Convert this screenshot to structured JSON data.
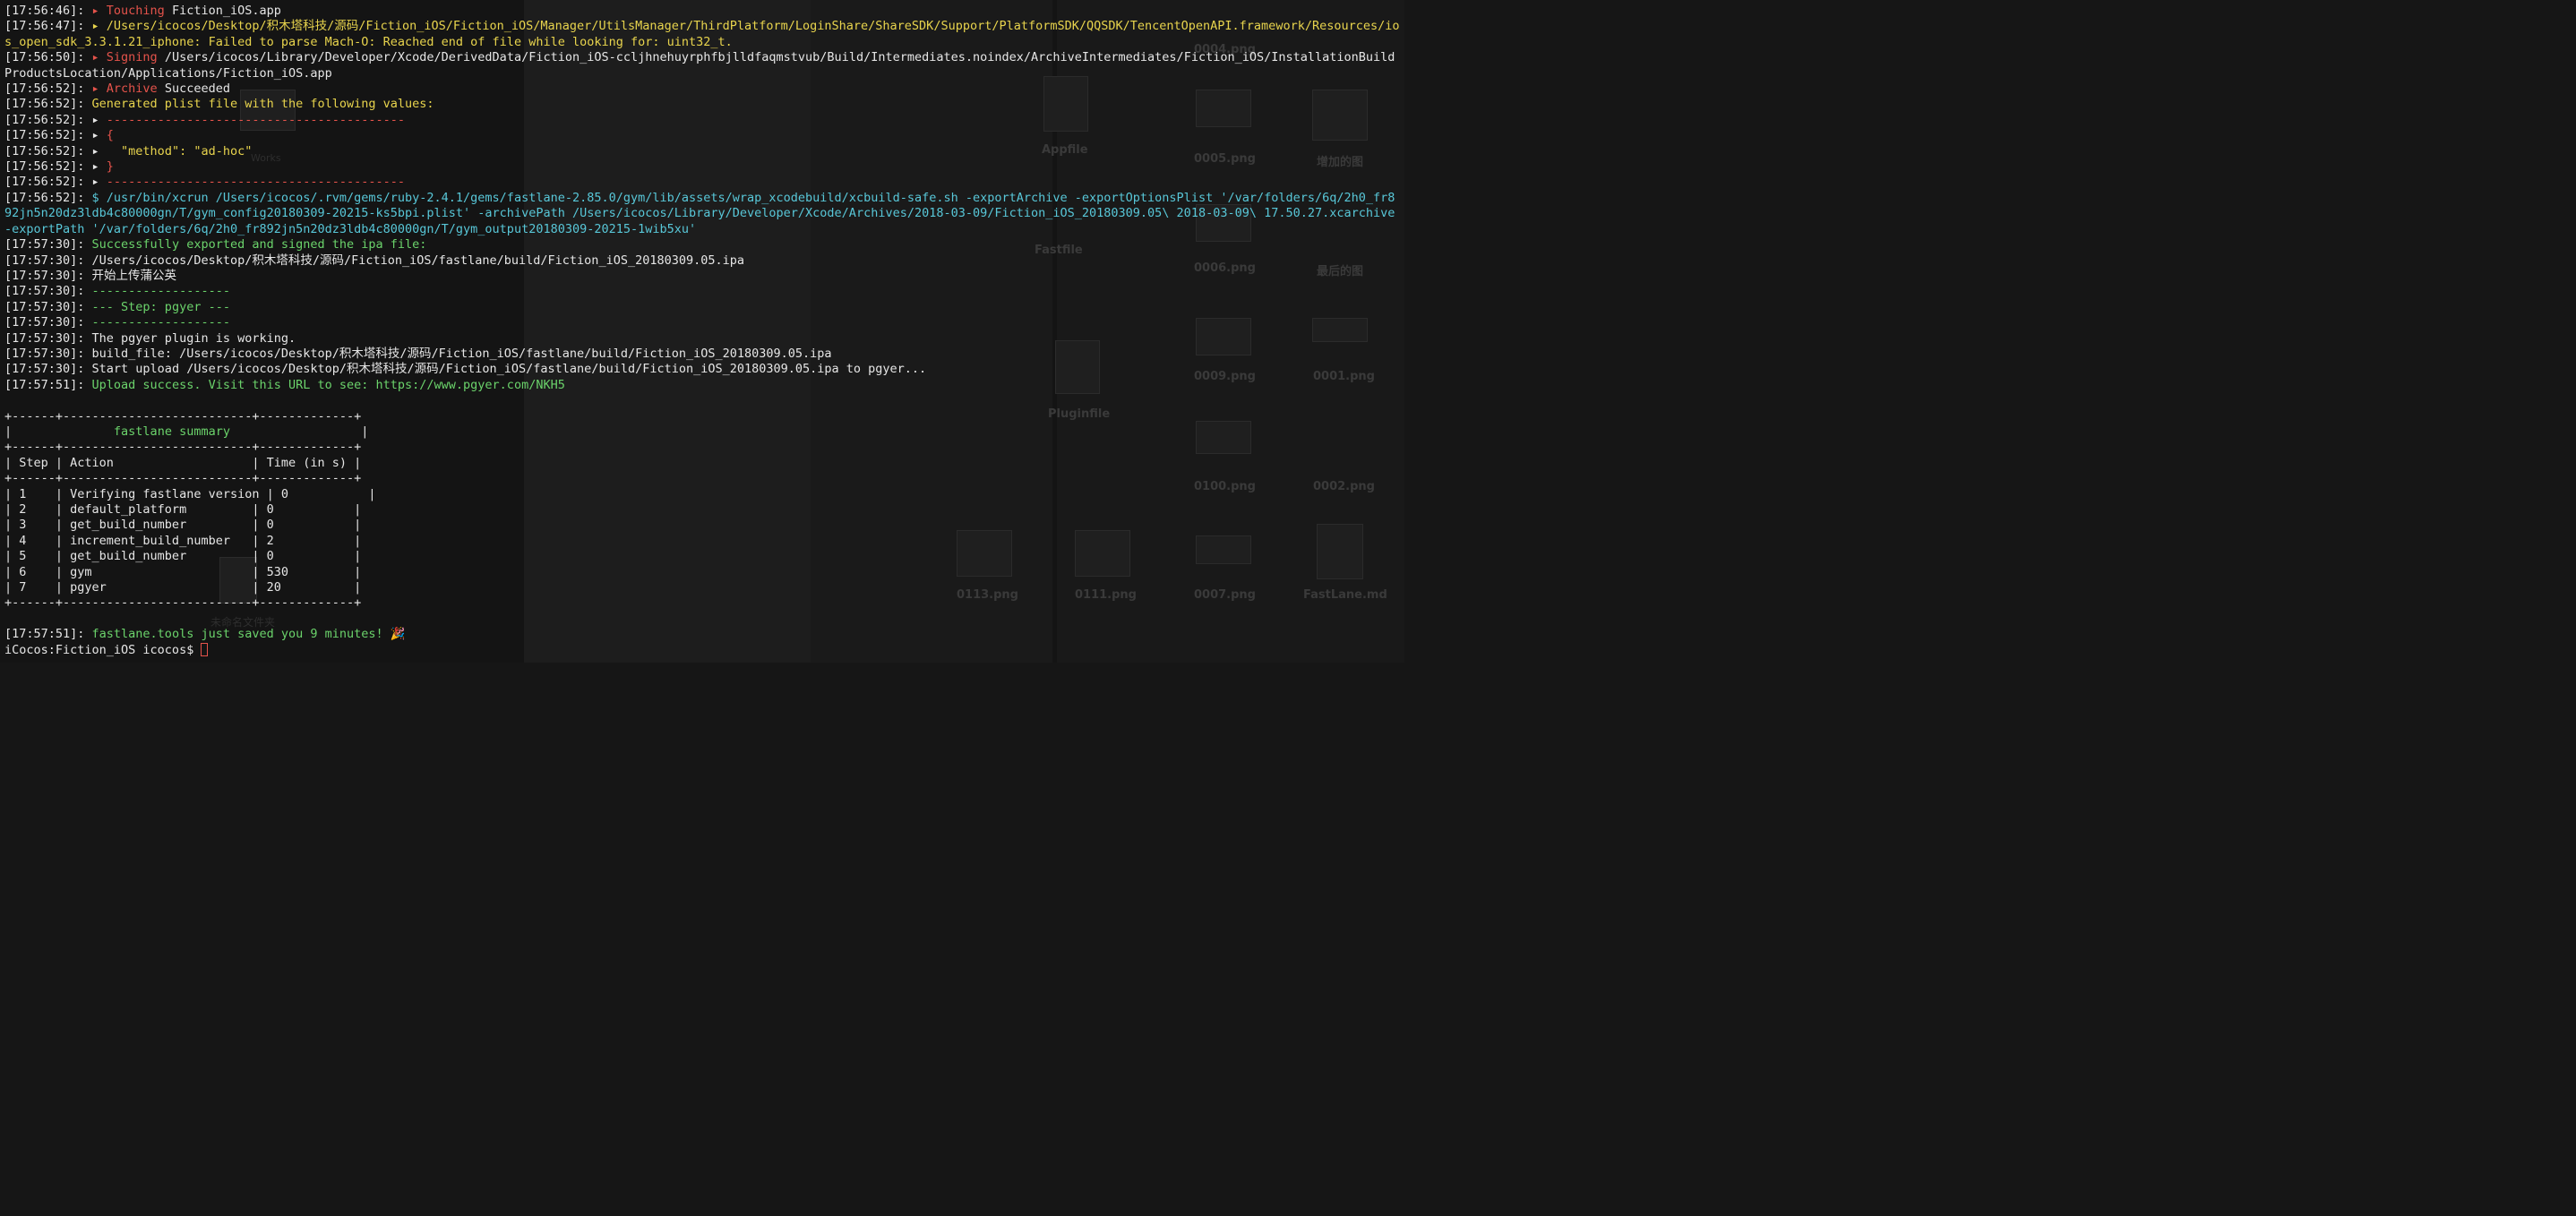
{
  "terminal": {
    "lines": [
      {
        "ts": "[17:56:46]:",
        "parts": [
          {
            "c": "red",
            "t": " ▸ Touching "
          },
          {
            "c": "wht",
            "t": "Fiction_iOS.app"
          }
        ]
      },
      {
        "ts": "[17:56:47]:",
        "wrap": true,
        "parts": [
          {
            "c": "yel",
            "t": " ▸ /Users/icocos/Desktop/积木塔科技/源码/Fiction_iOS/Fiction_iOS/Manager/UtilsManager/ThirdPlatform/LoginShare/ShareSDK/Support/PlatformSDK/QQSDK/TencentOpenAPI.framework/Resources/ios_open_sdk_3.3.1.21_iphone: Failed to parse Mach-O: Reached end of file while looking for: uint32_t."
          }
        ]
      },
      {
        "ts": "[17:56:50]:",
        "wrap": true,
        "parts": [
          {
            "c": "red",
            "t": " ▸ Signing "
          },
          {
            "c": "wht",
            "t": "/Users/icocos/Library/Developer/Xcode/DerivedData/Fiction_iOS-ccljhnehuyrphfbjlldfaqmstvub/Build/Intermediates.noindex/ArchiveIntermediates/Fiction_iOS/InstallationBuildProductsLocation/Applications/Fiction_iOS.app"
          }
        ]
      },
      {
        "ts": "[17:56:52]:",
        "parts": [
          {
            "c": "red",
            "t": " ▸ Archive "
          },
          {
            "c": "wht",
            "t": "Succeeded"
          }
        ]
      },
      {
        "ts": "[17:56:52]:",
        "parts": [
          {
            "c": "yel",
            "t": " Generated plist file with the following values:"
          }
        ]
      },
      {
        "ts": "[17:56:52]:",
        "parts": [
          {
            "c": "wht",
            "t": " ▸ "
          },
          {
            "c": "red",
            "t": "-----------------------------------------"
          }
        ]
      },
      {
        "ts": "[17:56:52]:",
        "parts": [
          {
            "c": "wht",
            "t": " ▸ "
          },
          {
            "c": "red",
            "t": "{"
          }
        ]
      },
      {
        "ts": "[17:56:52]:",
        "parts": [
          {
            "c": "wht",
            "t": " ▸   "
          },
          {
            "c": "yel",
            "t": "\"method\": \"ad-hoc\""
          }
        ]
      },
      {
        "ts": "[17:56:52]:",
        "parts": [
          {
            "c": "wht",
            "t": " ▸ "
          },
          {
            "c": "red",
            "t": "}"
          }
        ]
      },
      {
        "ts": "[17:56:52]:",
        "parts": [
          {
            "c": "wht",
            "t": " ▸ "
          },
          {
            "c": "red",
            "t": "-----------------------------------------"
          }
        ]
      },
      {
        "ts": "[17:56:52]:",
        "wrap": true,
        "parts": [
          {
            "c": "cyn",
            "t": " $ /usr/bin/xcrun /Users/icocos/.rvm/gems/ruby-2.4.1/gems/fastlane-2.85.0/gym/lib/assets/wrap_xcodebuild/xcbuild-safe.sh -exportArchive -exportOptionsPlist '/var/folders/6q/2h0_fr892jn5n20dz3ldb4c80000gn/T/gym_config20180309-20215-ks5bpi.plist' -archivePath /Users/icocos/Library/Developer/Xcode/Archives/2018-03-09/Fiction_iOS_20180309.05\\ 2018-03-09\\ 17.50.27.xcarchive -exportPath '/var/folders/6q/2h0_fr892jn5n20dz3ldb4c80000gn/T/gym_output20180309-20215-1wib5xu'"
          }
        ]
      },
      {
        "ts": "[17:57:30]:",
        "parts": [
          {
            "c": "grn",
            "t": " Successfully exported and signed the ipa file:"
          }
        ]
      },
      {
        "ts": "[17:57:30]:",
        "parts": [
          {
            "c": "wht",
            "t": " /Users/icocos/Desktop/积木塔科技/源码/Fiction_iOS/fastlane/build/Fiction_iOS_20180309.05.ipa"
          }
        ]
      },
      {
        "ts": "[17:57:30]:",
        "parts": [
          {
            "c": "wht",
            "t": " 开始上传蒲公英"
          }
        ]
      },
      {
        "ts": "[17:57:30]:",
        "parts": [
          {
            "c": "grn",
            "t": " -------------------"
          }
        ]
      },
      {
        "ts": "[17:57:30]:",
        "parts": [
          {
            "c": "grn",
            "t": " --- Step: pgyer ---"
          }
        ]
      },
      {
        "ts": "[17:57:30]:",
        "parts": [
          {
            "c": "grn",
            "t": " -------------------"
          }
        ]
      },
      {
        "ts": "[17:57:30]:",
        "parts": [
          {
            "c": "wht",
            "t": " The pgyer plugin is working."
          }
        ]
      },
      {
        "ts": "[17:57:30]:",
        "parts": [
          {
            "c": "wht",
            "t": " build_file: /Users/icocos/Desktop/积木塔科技/源码/Fiction_iOS/fastlane/build/Fiction_iOS_20180309.05.ipa"
          }
        ]
      },
      {
        "ts": "[17:57:30]:",
        "parts": [
          {
            "c": "wht",
            "t": " Start upload /Users/icocos/Desktop/积木塔科技/源码/Fiction_iOS/fastlane/build/Fiction_iOS_20180309.05.ipa to pgyer..."
          }
        ]
      },
      {
        "ts": "[17:57:51]:",
        "parts": [
          {
            "c": "grn",
            "t": " Upload success. Visit this URL to see: https://www.pgyer.com/NKH5"
          }
        ]
      }
    ],
    "summary": {
      "border_top": "+------+--------------------------+-------------+",
      "title_pre": "|              ",
      "title": "fastlane summary",
      "title_post": "                  |",
      "header": "| Step | Action                   | Time (in s) |",
      "rows": [
        "| 1    | Verifying fastlane version | 0           |",
        "| 2    | default_platform         | 0           |",
        "| 3    | get_build_number         | 0           |",
        "| 4    | increment_build_number   | 2           |",
        "| 5    | get_build_number         | 0           |",
        "| 6    | gym                      | 530         |",
        "| 7    | pgyer                    | 20          |"
      ]
    },
    "final_ts": "[17:57:51]:",
    "final_msg": " fastlane.tools just saved you 9 minutes! ",
    "final_emoji": "🎉",
    "prompt": "iCocos:Fiction_iOS icocos$ "
  },
  "background": {
    "folder_labels": [
      "Works",
      "Appfile",
      "Fastfile",
      "Pluginfile",
      "未命名文件夹"
    ],
    "file_labels": [
      "0004.png",
      "0005.png",
      "0006.png",
      "0009.png",
      "0001.png",
      "0100.png",
      "0002.png",
      "0113.png",
      "0111.png",
      "0007.png",
      "FastLane.md",
      "增加的图",
      "最后的图"
    ]
  }
}
